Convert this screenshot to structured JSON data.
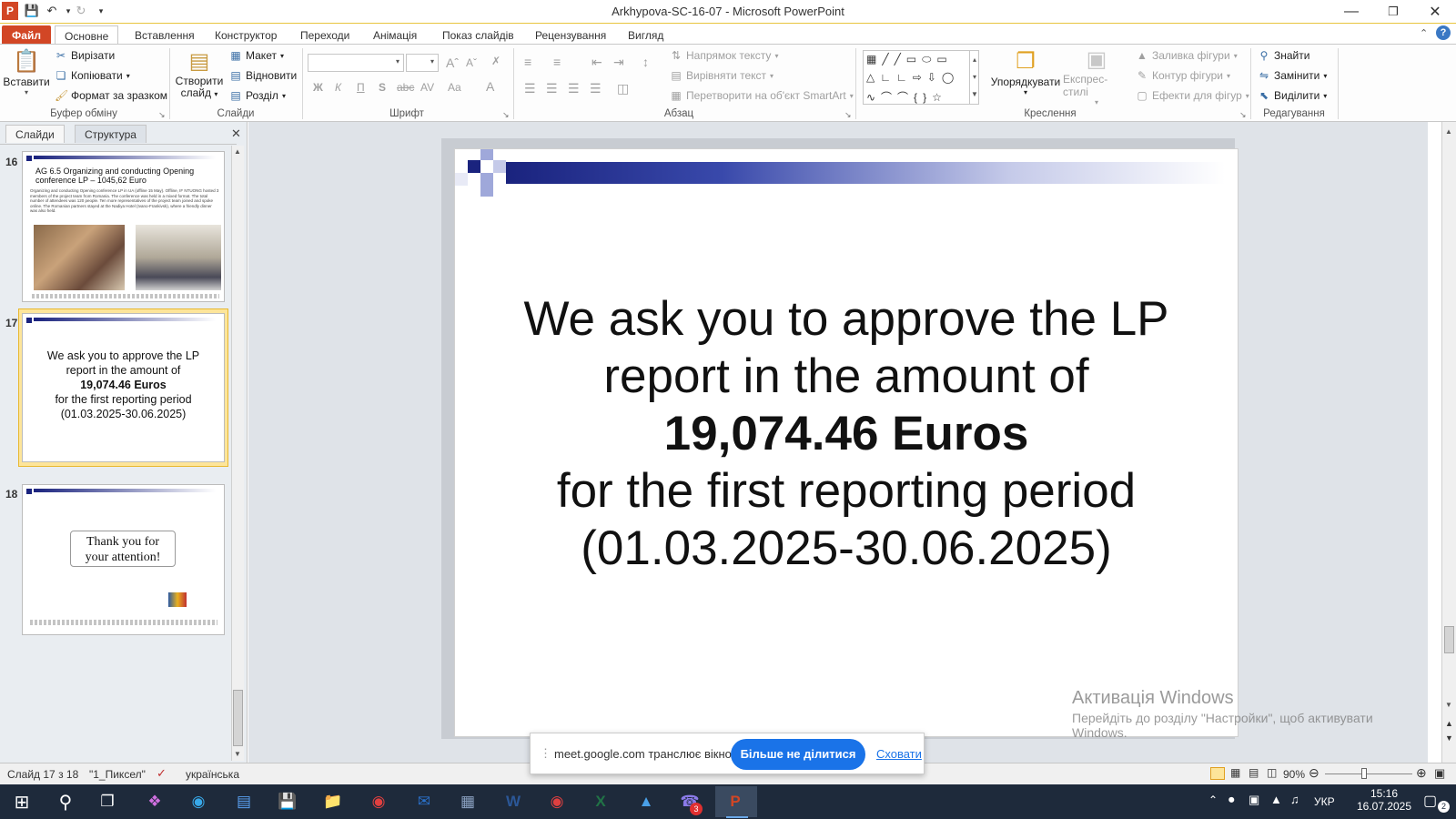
{
  "window": {
    "title": "Arkhypova-SC-16-07 - Microsoft PowerPoint"
  },
  "tabs": [
    {
      "label": "Файл"
    },
    {
      "label": "Основне"
    },
    {
      "label": "Вставлення"
    },
    {
      "label": "Конструктор"
    },
    {
      "label": "Переходи"
    },
    {
      "label": "Анімація"
    },
    {
      "label": "Показ слайдів"
    },
    {
      "label": "Рецензування"
    },
    {
      "label": "Вигляд"
    }
  ],
  "ribbon": {
    "clipboard": {
      "paste": "Вставити",
      "cut": "Вирізати",
      "copy": "Копіювати",
      "format_painter": "Формат за зразком",
      "label": "Буфер обміну"
    },
    "slides": {
      "new_slide_1": "Створити",
      "new_slide_2": "слайд",
      "layout": "Макет",
      "reset": "Відновити",
      "section": "Розділ",
      "label": "Слайди"
    },
    "font": {
      "label": "Шрифт",
      "bold": "Ж",
      "italic": "К",
      "underline": "П",
      "shadow": "S",
      "strike": "abc",
      "spacing": "AV",
      "case": "Aa",
      "color": "A"
    },
    "paragraph": {
      "label": "Абзац",
      "text_direction": "Напрямок тексту",
      "align_text": "Вирівняти текст",
      "smartart": "Перетворити на об'єкт SmartArt"
    },
    "drawing": {
      "label": "Креслення",
      "arrange": "Упорядкувати",
      "quick_styles": "Експрес-стилі",
      "fill": "Заливка фігури",
      "outline": "Контур фігури",
      "effects": "Ефекти для фігур"
    },
    "editing": {
      "label": "Редагування",
      "find": "Знайти",
      "replace": "Замінити",
      "select": "Виділити"
    }
  },
  "pane": {
    "tab_slides": "Слайди",
    "tab_outline": "Структура",
    "thumbs": [
      {
        "num": "16",
        "title": "AG 6.5 Organizing and conducting Opening conference LP – 1045,62 Euro",
        "body": "Organizing and conducting Opening conference LP in UA (offline 15 May). Offline, IF NTUONG hosted 3 members of the project team from Romania. The conference was held in a mixed format. The total number of attendees was 120 people. Ten more representatives of the project team joined and spoke online. The Romanian partners stayed at the Nadiya Hotel (Ivano-Frankivsk), where a friendly dinner was also held."
      },
      {
        "num": "17",
        "line1": "We ask you to approve the LP",
        "line2": "report in the amount of",
        "line3": "19,074.46 Euros",
        "line4": "for the first reporting period",
        "line5": "(01.03.2025-30.06.2025)"
      },
      {
        "num": "18",
        "line1": "Thank you for",
        "line2": "your attention!"
      }
    ]
  },
  "slide": {
    "line1": "We ask you to approve the LP",
    "line2": "report in the amount of",
    "line3": "19,074.46 Euros",
    "line4": "for the first reporting period",
    "line5": "(01.03.2025-30.06.2025)"
  },
  "watermark": {
    "line1": "Активація Windows",
    "line2": "Перейдіть до розділу \"Настройки\", щоб активувати",
    "line3": "Windows."
  },
  "share": {
    "text": "meet.google.com транслює вікно.",
    "stop": "Більше не ділитися",
    "hide": "Сховати"
  },
  "status": {
    "slide": "Слайд 17 з 18",
    "theme": "\"1_Пиксел\"",
    "language": "українська",
    "zoom": "90%"
  },
  "taskbar": {
    "lang": "УКР",
    "time": "15:16",
    "date": "16.07.2025",
    "teams_badge": "3",
    "notif_badge": "2"
  },
  "colors": {
    "accent_file": "#d24625",
    "slide_bar": "#1a237e",
    "share_button": "#1a73e8"
  }
}
